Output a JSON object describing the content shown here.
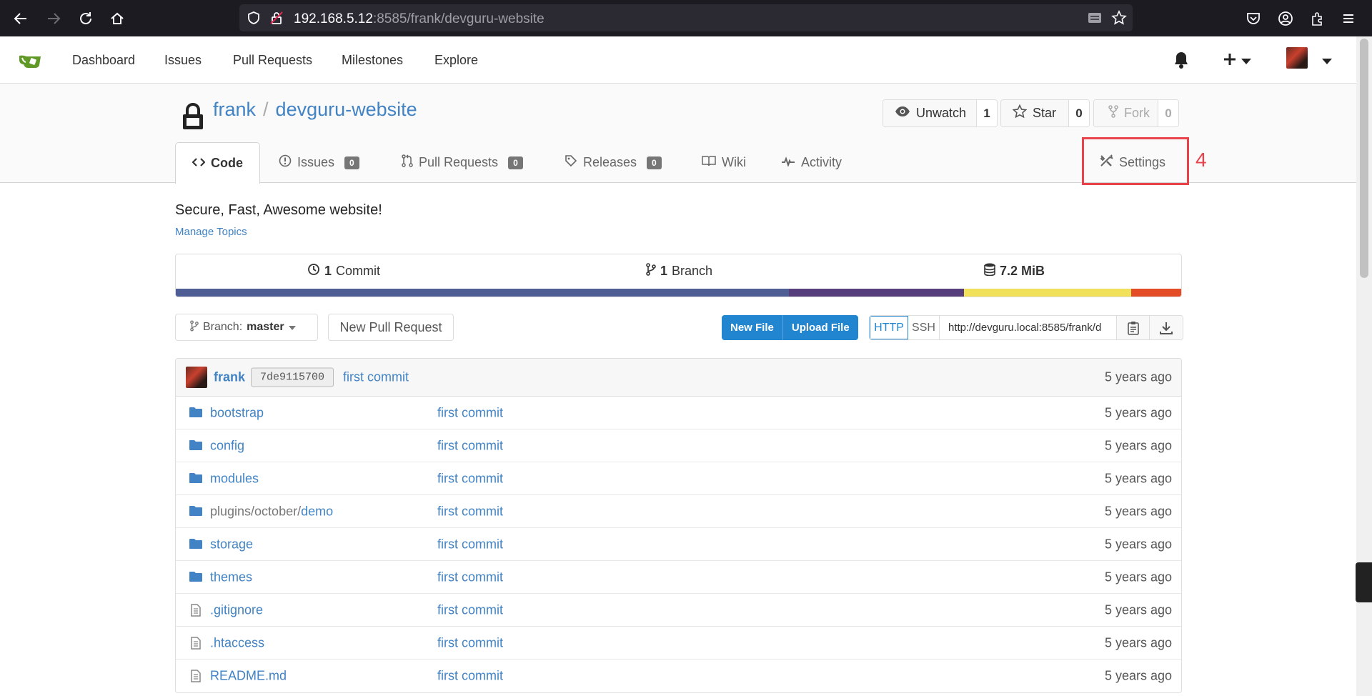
{
  "browser": {
    "url_host": "192.168.5.12",
    "url_rest": ":8585/frank/devguru-website"
  },
  "header": {
    "nav": [
      "Dashboard",
      "Issues",
      "Pull Requests",
      "Milestones",
      "Explore"
    ]
  },
  "repo": {
    "owner": "frank",
    "name": "devguru-website",
    "watch_label": "Unwatch",
    "watch_count": "1",
    "star_label": "Star",
    "star_count": "0",
    "fork_label": "Fork",
    "fork_count": "0",
    "tabs": {
      "code": "Code",
      "issues": "Issues",
      "issues_count": "0",
      "pulls": "Pull Requests",
      "pulls_count": "0",
      "releases": "Releases",
      "releases_count": "0",
      "wiki": "Wiki",
      "activity": "Activity",
      "settings": "Settings"
    },
    "annotation_number": "4",
    "description": "Secure, Fast, Awesome website!",
    "manage_topics": "Manage Topics",
    "stats": {
      "commits_num": "1",
      "commits_label": "Commit",
      "branches_num": "1",
      "branches_label": "Branch",
      "size": "7.2 MiB"
    },
    "language_bar": [
      {
        "color": "#4f5d95",
        "fraction": 0.61
      },
      {
        "color": "#563d7c",
        "fraction": 0.174
      },
      {
        "color": "#f1e05a",
        "fraction": 0.166
      },
      {
        "color": "#e34c26",
        "fraction": 0.05
      }
    ]
  },
  "toolbar": {
    "branch_prefix": "Branch:",
    "branch_name": "master",
    "new_pr": "New Pull Request",
    "new_file": "New File",
    "upload_file": "Upload File",
    "http": "HTTP",
    "ssh": "SSH",
    "clone_url": "http://devguru.local:8585/frank/d"
  },
  "latest_commit": {
    "author": "frank",
    "sha": "7de9115700",
    "message": "first commit",
    "age": "5 years ago"
  },
  "files": [
    {
      "type": "folder",
      "prefix": "",
      "name": "bootstrap",
      "message": "first commit",
      "age": "5 years ago"
    },
    {
      "type": "folder",
      "prefix": "",
      "name": "config",
      "message": "first commit",
      "age": "5 years ago"
    },
    {
      "type": "folder",
      "prefix": "",
      "name": "modules",
      "message": "first commit",
      "age": "5 years ago"
    },
    {
      "type": "folder",
      "prefix": "plugins/october/",
      "name": "demo",
      "message": "first commit",
      "age": "5 years ago"
    },
    {
      "type": "folder",
      "prefix": "",
      "name": "storage",
      "message": "first commit",
      "age": "5 years ago"
    },
    {
      "type": "folder",
      "prefix": "",
      "name": "themes",
      "message": "first commit",
      "age": "5 years ago"
    },
    {
      "type": "file",
      "prefix": "",
      "name": ".gitignore",
      "message": "first commit",
      "age": "5 years ago"
    },
    {
      "type": "file",
      "prefix": "",
      "name": ".htaccess",
      "message": "first commit",
      "age": "5 years ago"
    },
    {
      "type": "file",
      "prefix": "",
      "name": "README.md",
      "message": "first commit",
      "age": "5 years ago"
    }
  ]
}
